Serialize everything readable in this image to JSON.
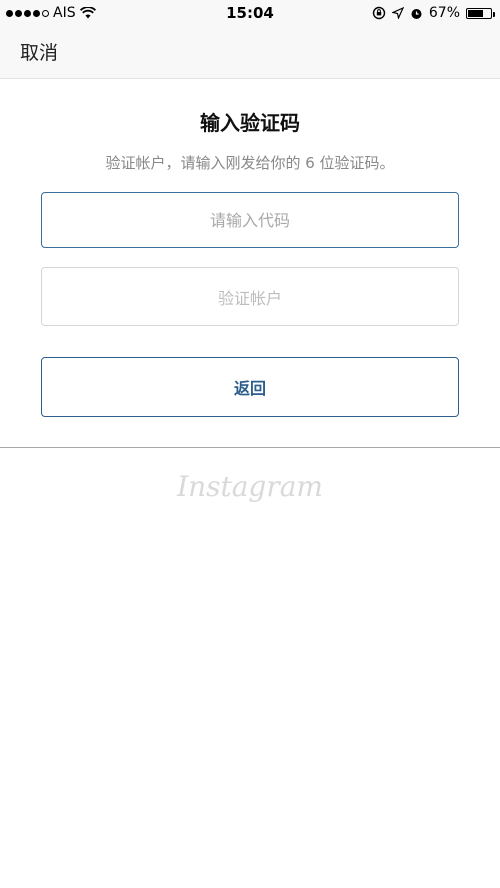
{
  "status_bar": {
    "carrier": "AIS",
    "time": "15:04",
    "battery_percent": "67%",
    "battery_level": 0.67,
    "icons": [
      "signal-dots-icon",
      "wifi-icon",
      "rotation-lock-icon",
      "location-arrow-icon",
      "alarm-clock-icon",
      "battery-icon"
    ]
  },
  "nav": {
    "cancel_label": "取消"
  },
  "main": {
    "title": "输入验证码",
    "subtitle": "验证帐户，请输入刚发给你的 6 位验证码。",
    "code_input": {
      "placeholder": "请输入代码",
      "value": ""
    },
    "verify_button_label": "验证帐户",
    "back_button_label": "返回"
  },
  "footer": {
    "logo_text": "Instagram"
  }
}
